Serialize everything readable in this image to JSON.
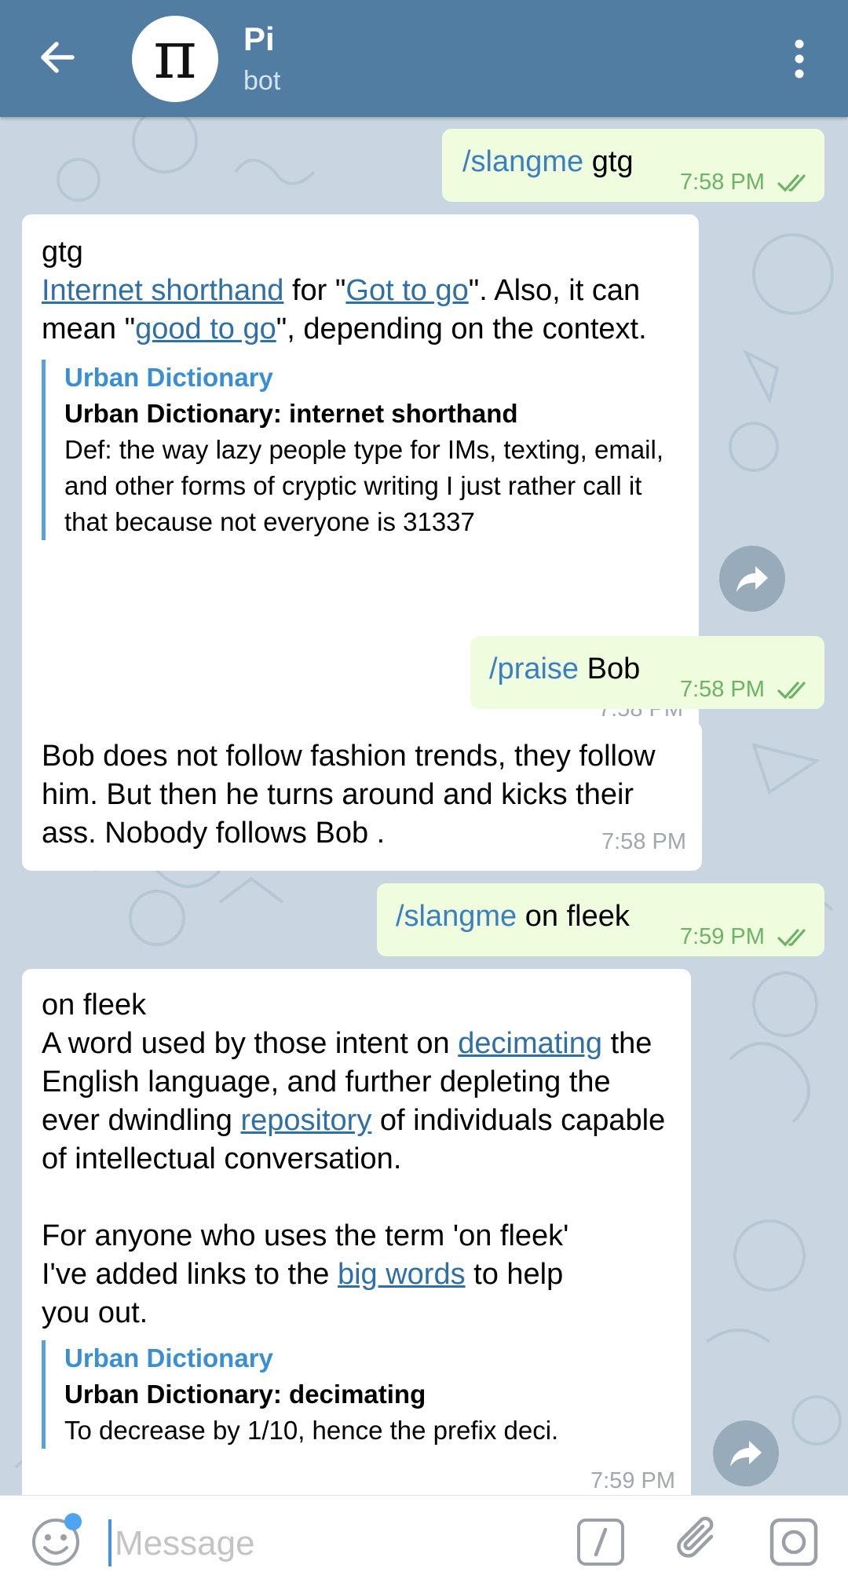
{
  "header": {
    "title": "Pi",
    "subtitle": "bot",
    "avatar_glyph": "π",
    "color": "#527da3"
  },
  "messages": [
    {
      "type": "out",
      "command": "/slangme",
      "text": " gtg",
      "time": "7:58 PM"
    },
    {
      "type": "in",
      "word": "gtg",
      "parts": [
        {
          "link": "Internet shorthand"
        },
        {
          "text": " for \""
        },
        {
          "link": "Got to go"
        },
        {
          "text": "\". Also, it can mean \""
        },
        {
          "link": "good to go"
        },
        {
          "text": "\", depending on the context."
        }
      ],
      "preview": {
        "site": "Urban Dictionary",
        "title": "Urban Dictionary: internet shorthand",
        "desc": "Def: the way lazy people type for IMs, texting, email, and other forms of cryptic writing I just rather call it that because not everyone is 31337"
      },
      "time": "7:58 PM"
    },
    {
      "type": "out",
      "command": "/praise",
      "text": " Bob",
      "time": "7:58 PM"
    },
    {
      "type": "in",
      "text": "Bob  does not follow fashion trends, they follow him. But then he turns around and kicks their ass. Nobody follows Bob .",
      "time": "7:58 PM"
    },
    {
      "type": "out",
      "command": "/slangme",
      "text": " on fleek",
      "time": "7:59 PM"
    },
    {
      "type": "in",
      "word": "on fleek",
      "def_parts": [
        {
          "text": "A word used by those intent on "
        },
        {
          "link": "decimating"
        },
        {
          "text": " the English language, and further depleting the ever dwindling "
        },
        {
          "link": "repository"
        },
        {
          "text": " of individuals capable of intellectual conversation."
        }
      ],
      "extra_parts": [
        {
          "text": "For anyone who uses the term 'on fleek' I've added links to the "
        },
        {
          "link": "big words"
        },
        {
          "text": " to help you out."
        }
      ],
      "preview": {
        "site": "Urban Dictionary",
        "title": "Urban Dictionary: decimating",
        "desc": "To decrease by 1/10, hence the prefix deci."
      },
      "time": "7:59 PM"
    }
  ],
  "input": {
    "placeholder": "Message"
  },
  "icons": {
    "back": "back-arrow-icon",
    "menu": "more-vertical-icon",
    "share": "share-icon",
    "emoji": "emoji-icon",
    "command": "slash-command-icon",
    "attach": "paperclip-icon",
    "camera": "camera-icon"
  },
  "colors": {
    "out_bubble": "#effdde",
    "in_bubble": "#ffffff",
    "link": "#2f6fa8",
    "command": "#3a7fbf",
    "out_time": "#6cb465"
  }
}
